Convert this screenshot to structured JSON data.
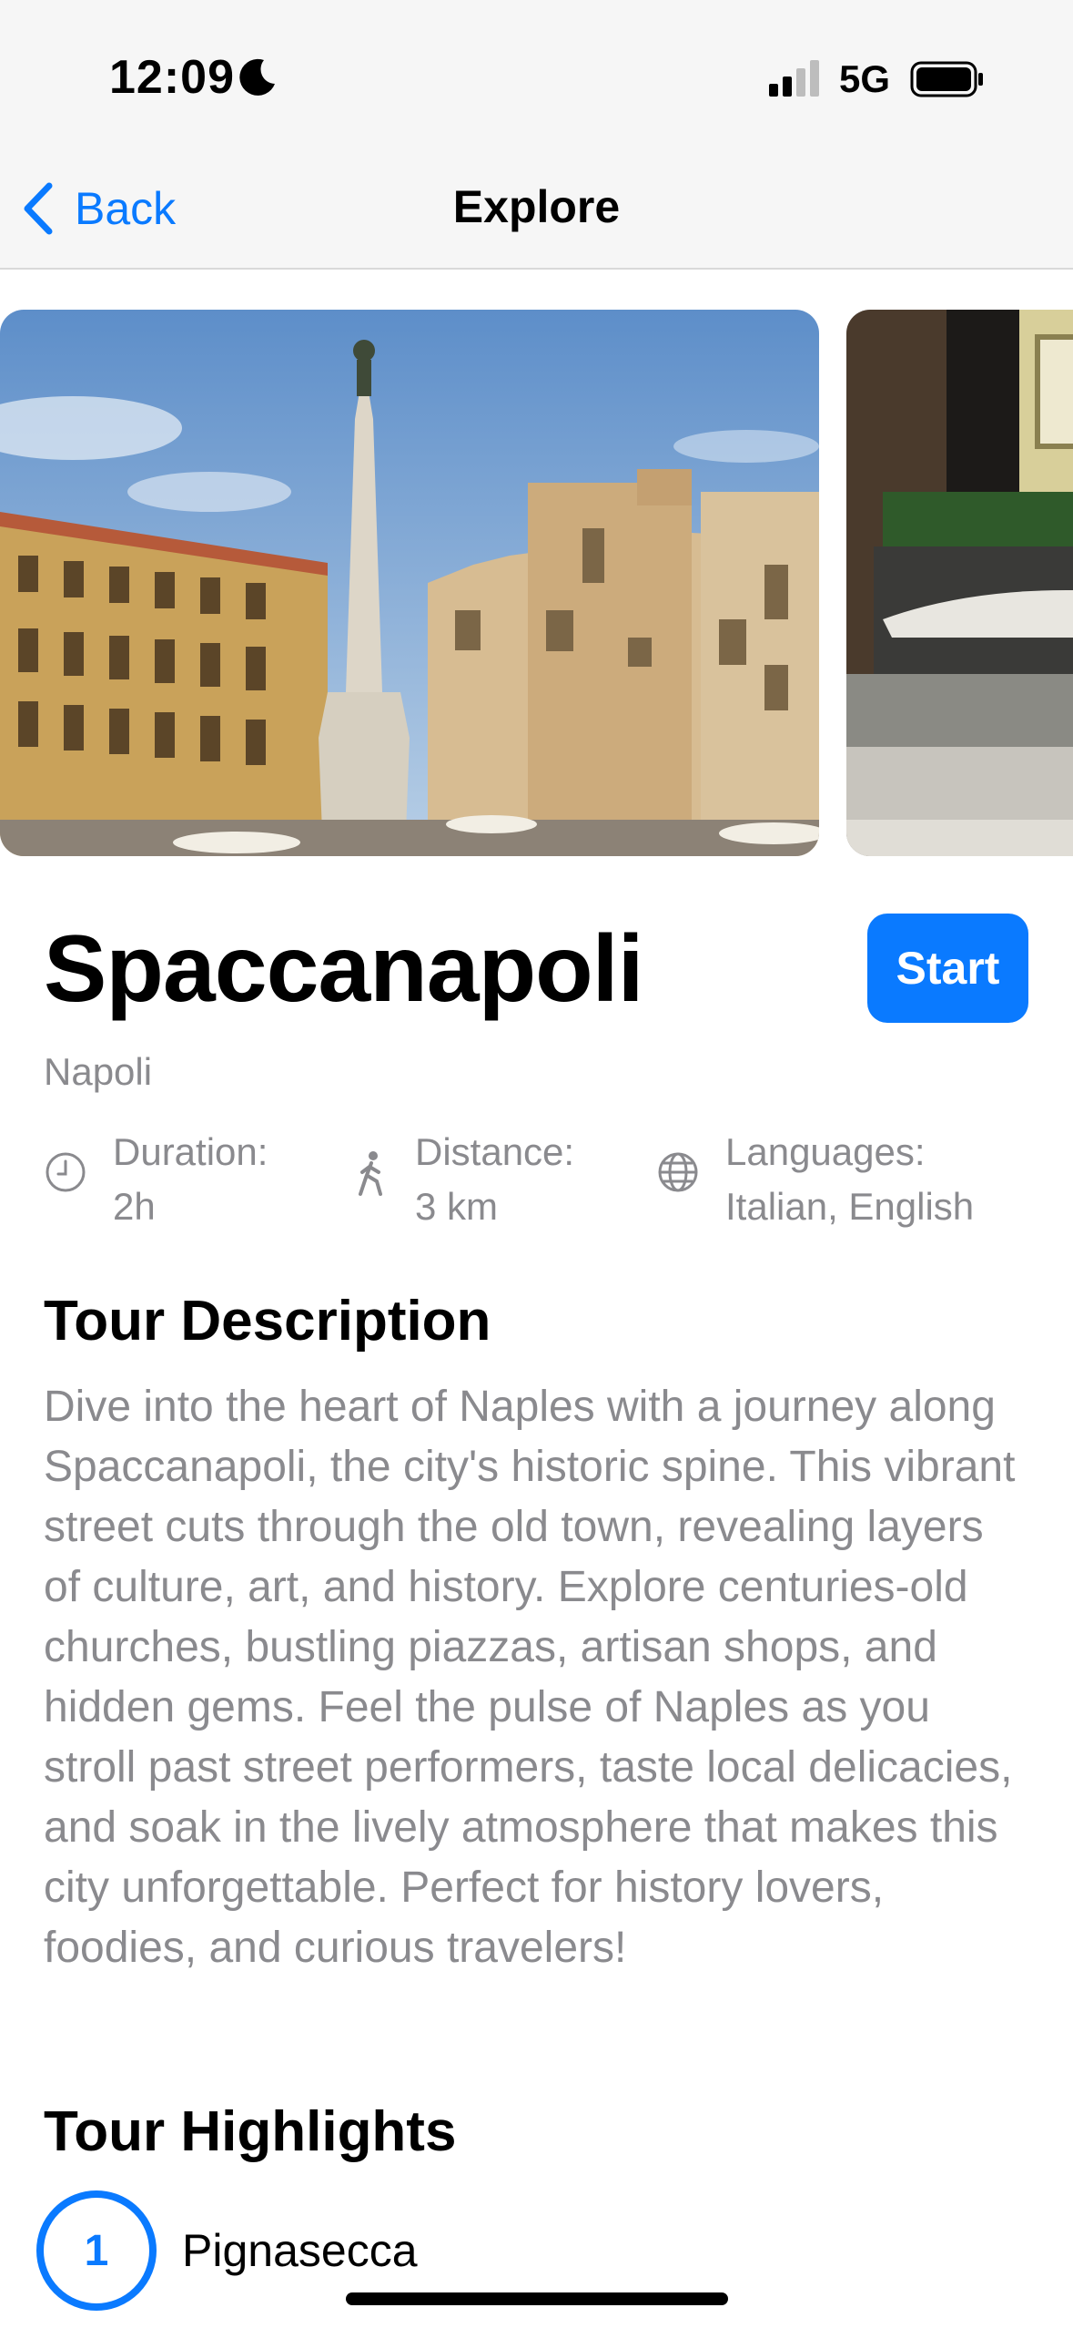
{
  "status": {
    "time": "12:09",
    "network": "5G"
  },
  "nav": {
    "back_label": "Back",
    "title": "Explore"
  },
  "tour": {
    "title": "Spaccanapoli",
    "start_label": "Start",
    "city": "Napoli",
    "stats": [
      {
        "icon": "clock-icon",
        "label": "Duration:",
        "value": "2h"
      },
      {
        "icon": "walking-icon",
        "label": "Distance:",
        "value": "3 km"
      },
      {
        "icon": "globe-icon",
        "label": "Languages:",
        "value": "Italian, English"
      }
    ],
    "description_heading": "Tour Description",
    "description": "Dive into the heart of Naples with a journey along Spaccanapoli, the city's historic spine. This vibrant street cuts through the old town, revealing layers of culture, art, and history. Explore centuries-old churches, bustling piazzas, artisan shops, and hidden gems. Feel the pulse of Naples as you stroll past street performers, taste local delicacies, and soak in the lively atmosphere that makes this city unforgettable. Perfect for history lovers, foodies, and curious travelers!",
    "highlights_heading": "Tour Highlights",
    "highlights": [
      {
        "number": "1",
        "name": "Pignasecca"
      }
    ]
  },
  "colors": {
    "accent": "#0a7aff",
    "secondary_text": "#8a8a8e"
  }
}
